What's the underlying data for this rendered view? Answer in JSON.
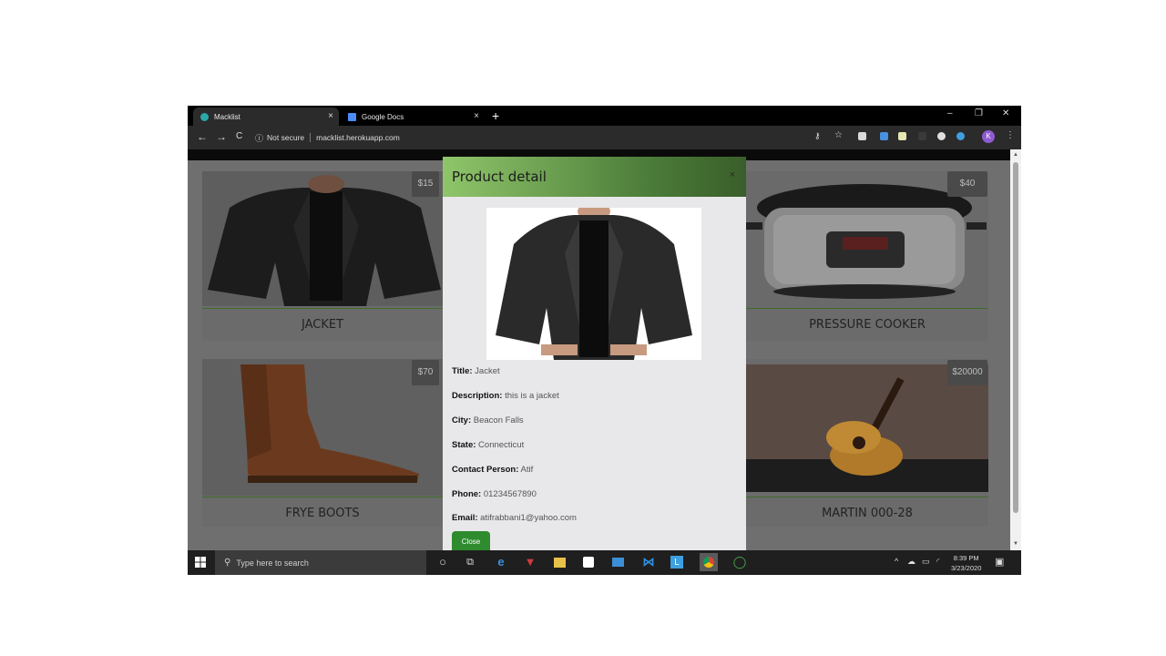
{
  "browser": {
    "tabs": [
      {
        "label": "Macklist",
        "close": "×"
      },
      {
        "label": "Google Docs",
        "close": "×"
      }
    ],
    "new_tab": "+",
    "window_controls": {
      "minimize": "–",
      "restore": "❐",
      "close": "✕"
    },
    "nav": {
      "back": "←",
      "forward": "→",
      "reload": "C"
    },
    "security_label": "Not secure",
    "url": "macklist.herokuapp.com",
    "profile_initial": "K",
    "menu": "⋮"
  },
  "products": [
    {
      "title": "JACKET",
      "price": "$15"
    },
    {
      "title": "PRESSURE COOKER",
      "price": "$40"
    },
    {
      "title": "FRYE BOOTS",
      "price": "$70"
    },
    {
      "title": "MARTIN 000-28",
      "price": "$20000"
    }
  ],
  "modal": {
    "title": "Product detail",
    "close_x": "×",
    "fields": [
      {
        "label": "Title:",
        "value": "Jacket"
      },
      {
        "label": "Description:",
        "value": "this is a jacket"
      },
      {
        "label": "City:",
        "value": "Beacon Falls"
      },
      {
        "label": "State:",
        "value": "Connecticut"
      },
      {
        "label": "Contact Person:",
        "value": "Atif"
      },
      {
        "label": "Phone:",
        "value": "01234567890"
      },
      {
        "label": "Email:",
        "value": "atifrabbani1@yahoo.com"
      }
    ],
    "close_button": "Close"
  },
  "taskbar": {
    "search_placeholder": "Type here to search",
    "time": "8:39 PM",
    "date": "3/23/2020"
  },
  "colors": {
    "modal_header_start": "#8fc56a",
    "modal_header_end": "#3a5e2a",
    "close_button": "#2e8b2e",
    "card_divider": "#3f6b2a"
  }
}
